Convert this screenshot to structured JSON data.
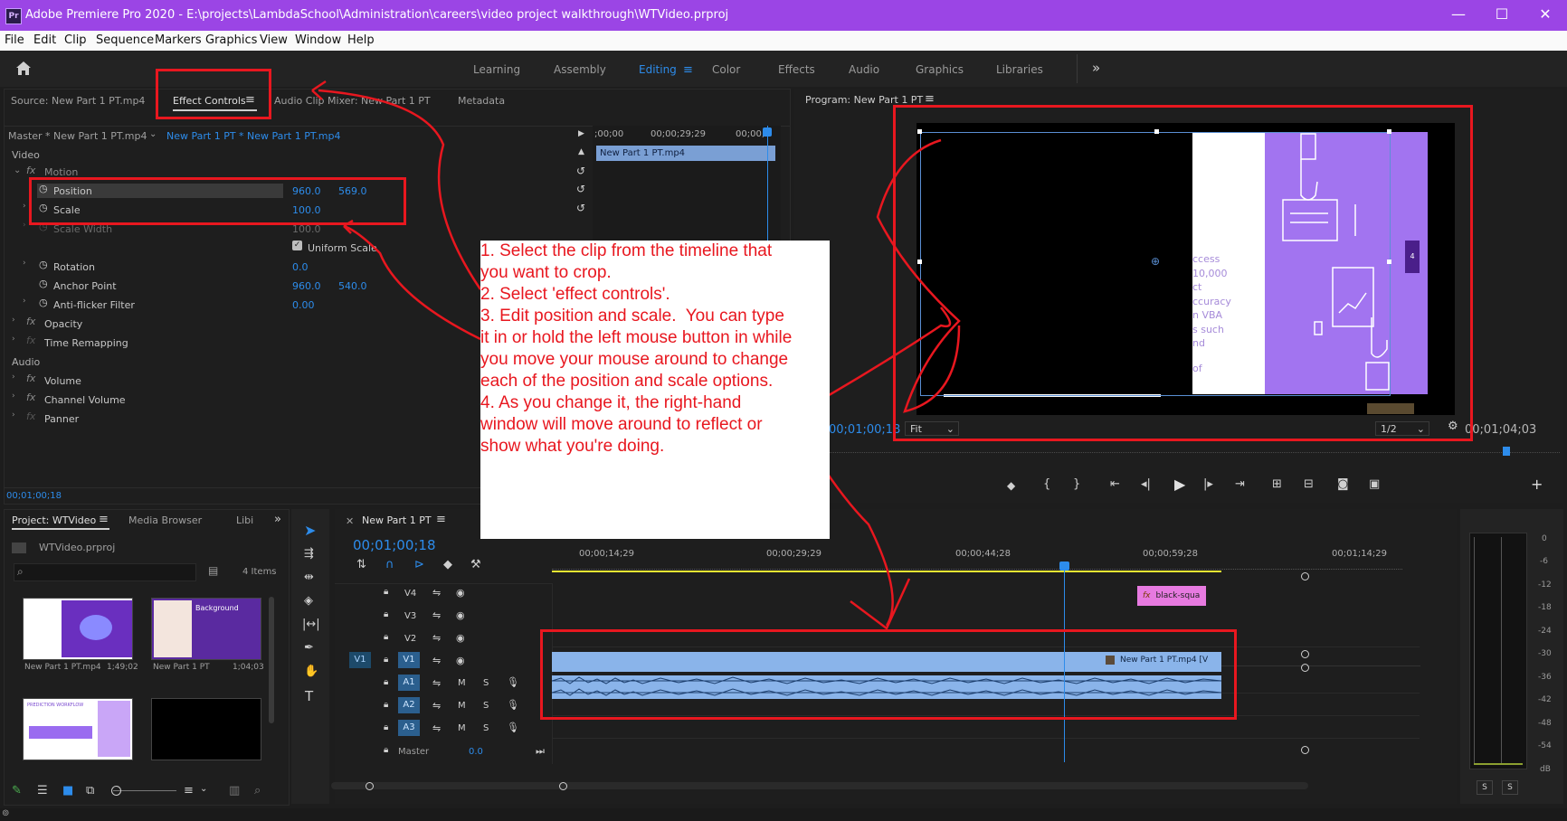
{
  "titlebar": {
    "title": "Adobe Premiere Pro 2020 - E:\\projects\\LambdaSchool\\Administration\\careers\\video project walkthrough\\WTVideo.prproj",
    "logo": "Pr",
    "minimize": "—",
    "maximize": "☐",
    "close": "✕"
  },
  "menu": [
    "File",
    "Edit",
    "Clip",
    "Sequence",
    "Markers",
    "Graphics",
    "View",
    "Window",
    "Help"
  ],
  "workspaces": [
    "Learning",
    "Assembly",
    "Editing",
    "Color",
    "Effects",
    "Audio",
    "Graphics",
    "Libraries"
  ],
  "workspace_more": "»",
  "source_tabs": {
    "source": "Source: New Part 1 PT.mp4",
    "effect_controls": "Effect Controls",
    "audio_mixer": "Audio Clip Mixer: New Part 1 PT",
    "metadata": "Metadata"
  },
  "effect_controls": {
    "master": "Master * New Part 1 PT.mp4",
    "sequence": "New Part 1 PT * New Part 1 PT.mp4",
    "video_label": "Video",
    "motion": "Motion",
    "position_label": "Position",
    "position_x": "960.0",
    "position_y": "569.0",
    "scale_label": "Scale",
    "scale_val": "100.0",
    "scale_width_label": "Scale Width",
    "scale_width_val": "100.0",
    "uniform_scale": "Uniform Scale",
    "rotation_label": "Rotation",
    "rotation_val": "0.0",
    "anchor_label": "Anchor Point",
    "anchor_x": "960.0",
    "anchor_y": "540.0",
    "antiflicker_label": "Anti-flicker Filter",
    "antiflicker_val": "0.00",
    "opacity": "Opacity",
    "time_remap": "Time Remapping",
    "audio_label": "Audio",
    "volume": "Volume",
    "channel_volume": "Channel Volume",
    "panner": "Panner",
    "mini_tc1": ";00;00",
    "mini_tc2": "00;00;29;29",
    "mini_tc3": "00;00;5",
    "mini_clip": "New Part 1 PT.mp4",
    "timecode": "00;01;00;18"
  },
  "program": {
    "title": "Program: New Part 1 PT",
    "timecode": "00;01;00;18",
    "fit": "Fit",
    "res": "1/2",
    "duration": "00;01;04;03",
    "slide_text": [
      "ccess",
      "10,000",
      "ct",
      "ccuracy",
      "n VBA",
      "s such",
      "nd",
      "of"
    ],
    "tab4": "4"
  },
  "project": {
    "tab": "Project: WTVideo",
    "media_browser": "Media Browser",
    "libraries": "Libi",
    "file": "WTVideo.prproj",
    "items": "4 Items",
    "thumbs": [
      {
        "name": "New Part 1 PT.mp4",
        "dur": "1;49;02"
      },
      {
        "name": "New Part 1 PT",
        "dur": "1;04;03"
      }
    ],
    "background_label": "Background",
    "workflow_label": "PREDICTION WORKFLOW"
  },
  "timeline": {
    "tab": "New Part 1 PT",
    "timecode": "00;01;00;18",
    "ruler": [
      "00;00;14;29",
      "00;00;29;29",
      "00;00;44;28",
      "00;00;59;28",
      "00;01;14;29"
    ],
    "tracks": [
      "V4",
      "V3",
      "V2",
      "V1",
      "A1",
      "A2",
      "A3"
    ],
    "source_patch_v": "V1",
    "master": "Master",
    "master_val": "0.0",
    "clip_black": "black-squa",
    "clip_video": "New Part 1 PT.mp4 [V",
    "m": "M",
    "s": "S"
  },
  "meters": {
    "ticks": [
      "0",
      "-6",
      "-12",
      "-18",
      "-24",
      "-30",
      "-36",
      "-42",
      "-48",
      "-54",
      "dB"
    ],
    "solo_l": "S",
    "solo_r": "S"
  },
  "annotation": {
    "lines": [
      "1. Select the clip from the timeline that",
      "you want to crop.",
      "2. Select 'effect controls'.",
      "3. Edit position and scale.  You can type",
      "it in or hold the left mouse button in while",
      "you move your mouse around to change",
      "each of the position and scale options.",
      "4. As you change it, the right-hand",
      "window will move around to reflect or",
      "show what you're doing."
    ]
  },
  "colors": {
    "accent": "#2d8ceb",
    "title_purple": "#9b45e5",
    "annotation_red": "#e8171f"
  }
}
